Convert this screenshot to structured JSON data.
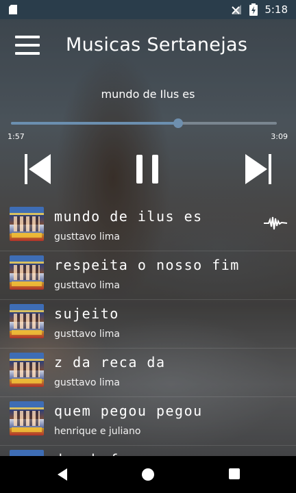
{
  "status": {
    "time": "5:18",
    "icons": [
      "sd-card-icon",
      "no-signal-icon",
      "battery-charging-icon"
    ]
  },
  "header": {
    "title": "Musicas Sertanejas",
    "menu_icon": "hamburger-menu-icon"
  },
  "player": {
    "now_playing": "mundo de Ilus es",
    "elapsed": "1:57",
    "duration": "3:09",
    "progress": 0.63,
    "buttons": [
      "previous-icon",
      "pause-icon",
      "next-icon"
    ]
  },
  "songs": [
    {
      "title": "mundo de ilus es",
      "artist": "gusttavo lima",
      "playing": true
    },
    {
      "title": "respeita o nosso fim",
      "artist": "gusttavo lima"
    },
    {
      "title": "sujeito",
      "artist": "gusttavo lima"
    },
    {
      "title": "z da reca da",
      "artist": "gusttavo lima"
    },
    {
      "title": "quem pegou pegou",
      "artist": "henrique e juliano"
    },
    {
      "title": "desabafo",
      "artist": ""
    }
  ],
  "colors": {
    "accent": "#6b8fb0",
    "statusbar": "#283c4b",
    "navbar": "#000000"
  },
  "nav": [
    "back-icon",
    "home-icon",
    "recents-icon"
  ]
}
